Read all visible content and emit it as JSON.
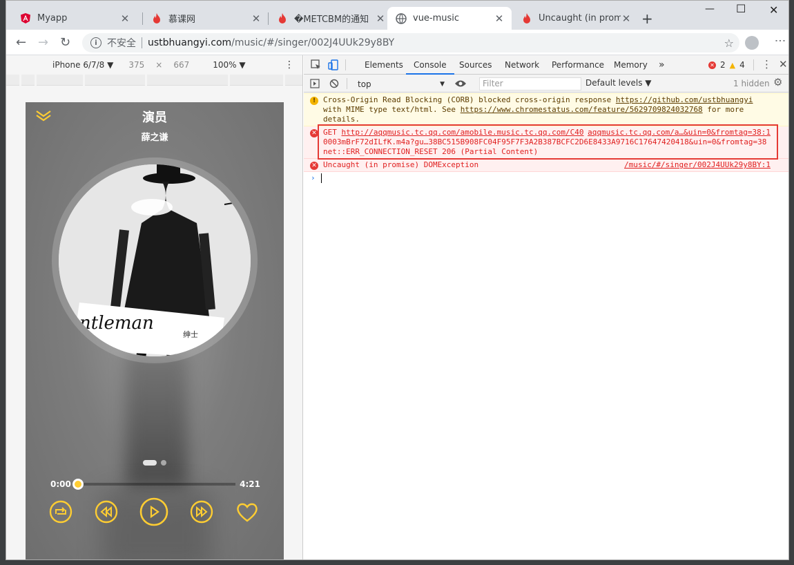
{
  "tabs": [
    {
      "title": "Myapp",
      "icon": "angular-icon",
      "active": false
    },
    {
      "title": "慕课网",
      "icon": "flame-icon",
      "active": false
    },
    {
      "title": "�METCBM的通知",
      "icon": "flame-icon",
      "active": false
    },
    {
      "title": "vue-music",
      "icon": "globe-icon",
      "active": true
    },
    {
      "title": "Uncaught (in promis",
      "icon": "flame-icon",
      "active": false
    }
  ],
  "omnibox": {
    "security_label": "不安全",
    "host": "ustbhuangyi.com",
    "path": "/music/#/singer/002J4UUk29y8BY"
  },
  "device_toolbar": {
    "device": "iPhone 6/7/8 ▼",
    "width": "375",
    "times": "×",
    "height": "667",
    "zoom": "100% ▼"
  },
  "player": {
    "song_title": "演员",
    "singer": "薛之谦",
    "current_time": "0:00",
    "total_time": "4:21",
    "progress_fraction": 0.0,
    "cd_caption": "ntleman",
    "cd_sub": "绅士",
    "accent_color": "#ffcd32"
  },
  "devtools": {
    "panels": [
      "Elements",
      "Console",
      "Sources",
      "Network",
      "Performance",
      "Memory"
    ],
    "more": "»",
    "active_panel": "Console",
    "error_count": "2",
    "warning_count": "4",
    "context": "top",
    "filter_placeholder": "Filter",
    "levels": "Default levels ▼",
    "hidden": "1 hidden"
  },
  "console": {
    "warning": {
      "text1": "Cross-Origin Read Blocking (CORB) blocked cross-origin response ",
      "link1": "https://github.com/ustbhuangyi",
      "text2": "with MIME type text/html. See ",
      "link2": "https://www.chromestatus.com/feature/5629709824032768",
      "text3": " for more",
      "text4": "details."
    },
    "error1": {
      "method": "GET ",
      "url1": "http://aqqmusic.tc.qq.com/amobile.music.tc.qq.com/C40",
      "source": "aqqmusic.tc.qq.com/a…&uin=0&fromtag=38:1",
      "line2": "0003mBrF72dILfK.m4a?gu…38BC515B908FC04F95F7F3A2B387BCFC2D6E8433A9716C17647420418&uin=0&fromtag=38",
      "line3": "net::ERR_CONNECTION_RESET 206 (Partial Content)"
    },
    "error2": {
      "text": "Uncaught (in promise) DOMException",
      "source": "/music/#/singer/002J4UUk29y8BY:1"
    },
    "prompt": "›"
  }
}
